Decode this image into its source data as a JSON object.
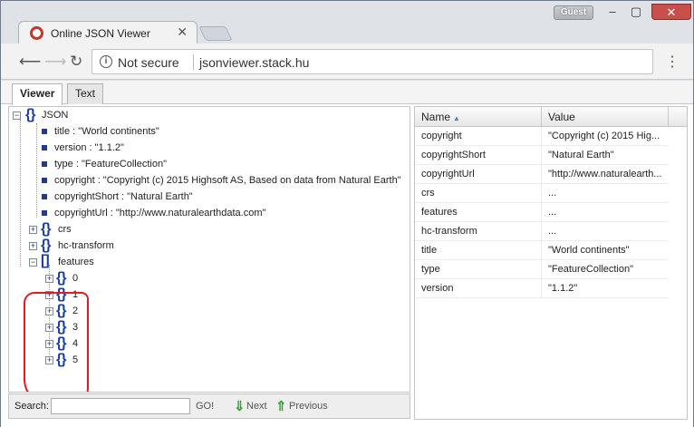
{
  "browser": {
    "tab_title": "Online JSON Viewer",
    "profile_label": "Guest",
    "security_label": "Not secure",
    "url": "jsonviewer.stack.hu"
  },
  "viewer_tabs": [
    "Viewer",
    "Text"
  ],
  "tree": {
    "root_label": "JSON",
    "leaves": [
      "title : \"World continents\"",
      "version : \"1.1.2\"",
      "type : \"FeatureCollection\"",
      "copyright : \"Copyright (c) 2015 Highsoft AS, Based on data from Natural Earth\"",
      "copyrightShort : \"Natural Earth\"",
      "copyrightUrl : \"http://www.naturalearthdata.com\""
    ],
    "objects": [
      "crs",
      "hc-transform"
    ],
    "features_label": "features",
    "feature_items": [
      "0",
      "1",
      "2",
      "3",
      "4",
      "5"
    ]
  },
  "search": {
    "label": "Search:",
    "go_label": "GO!",
    "next_label": "Next",
    "previous_label": "Previous"
  },
  "grid": {
    "col_name": "Name",
    "col_value": "Value",
    "rows": [
      {
        "name": "copyright",
        "value": "\"Copyright (c) 2015 Hig..."
      },
      {
        "name": "copyrightShort",
        "value": "\"Natural Earth\""
      },
      {
        "name": "copyrightUrl",
        "value": "\"http://www.naturalearth..."
      },
      {
        "name": "crs",
        "value": "..."
      },
      {
        "name": "features",
        "value": "..."
      },
      {
        "name": "hc-transform",
        "value": "..."
      },
      {
        "name": "title",
        "value": "\"World continents\""
      },
      {
        "name": "type",
        "value": "\"FeatureCollection\""
      },
      {
        "name": "version",
        "value": "\"1.1.2\""
      }
    ]
  }
}
